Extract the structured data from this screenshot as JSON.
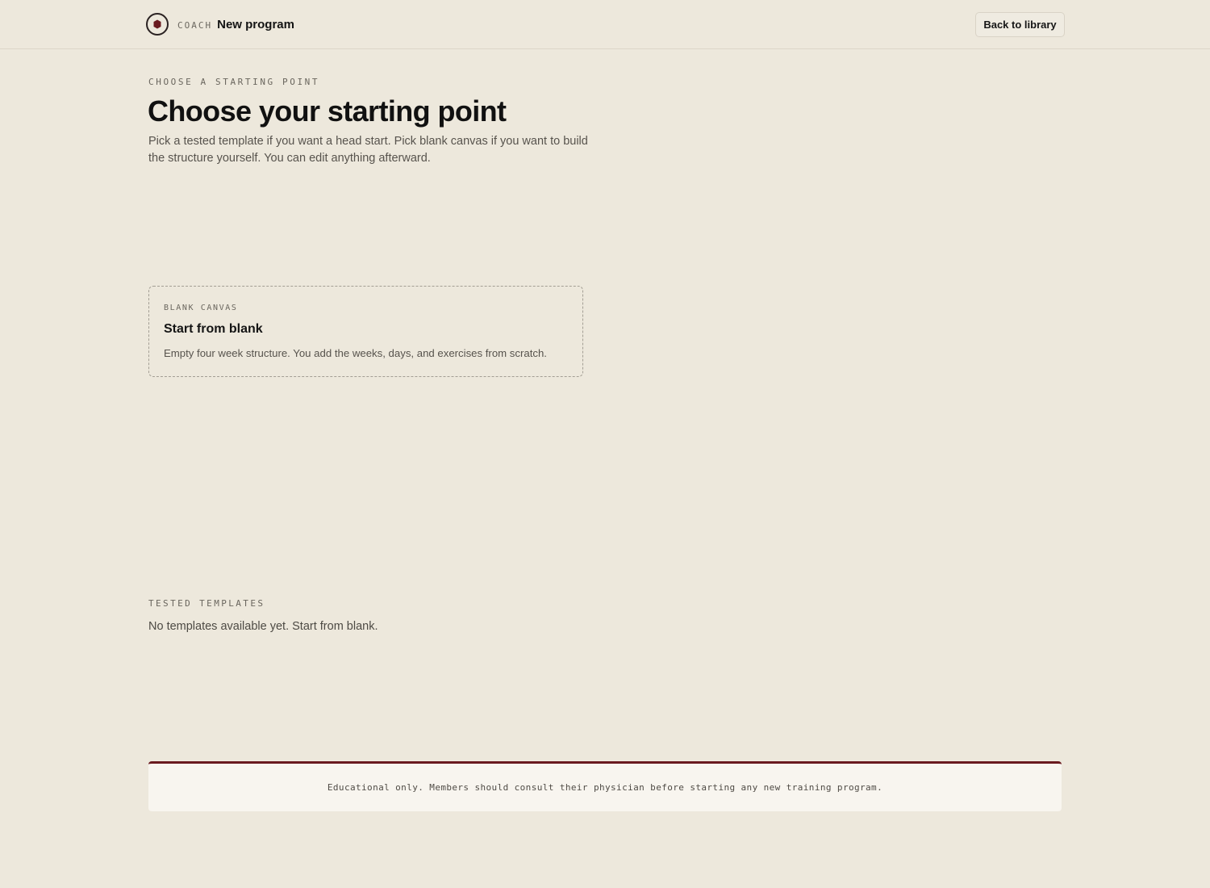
{
  "header": {
    "brand_kicker": "COACH",
    "page_title": "New program",
    "back_label": "Back to library",
    "logo_icon": "shield-hexagon-icon",
    "accent_color": "#6a1a1f"
  },
  "intro": {
    "kicker": "CHOOSE A STARTING POINT",
    "title": "Choose your starting point",
    "description": "Pick a tested template if you want a head start. Pick blank canvas if you want to build the structure yourself. You can edit anything afterward."
  },
  "blank_card": {
    "kicker": "BLANK CANVAS",
    "title": "Start from blank",
    "description": "Empty four week structure. You add the weeks, days, and exercises from scratch."
  },
  "templates": {
    "kicker": "TESTED TEMPLATES",
    "empty_message": "No templates available yet. Start from blank."
  },
  "footer": {
    "disclaimer": "Educational only. Members should consult their physician before starting any new training program."
  }
}
